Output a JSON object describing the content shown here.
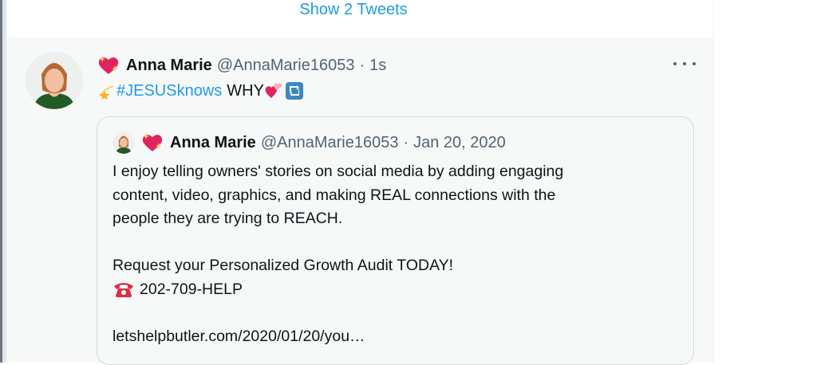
{
  "thread": {
    "show_more_label": "Show 2 Tweets"
  },
  "tweet": {
    "display_name": "Anna Marie",
    "handle": "@AnnaMarie16053",
    "separator": "·",
    "time": "1s",
    "hashtag": "#JESUSknows",
    "text_after": "WHY",
    "emoji": [
      "sparkling-heart-icon",
      "dizzy-star-icon",
      "two-hearts-icon",
      "retweet-box-icon"
    ]
  },
  "quote": {
    "display_name": "Anna Marie",
    "handle": "@AnnaMarie16053",
    "separator": "·",
    "date": "Jan 20, 2020",
    "lines": [
      "I enjoy telling owners' stories on social media by adding engaging",
      "content, video, graphics, and making REAL connections with the",
      "people they are trying to REACH."
    ],
    "cta": "Request your Personalized Growth Audit TODAY!",
    "phone": "202-709-HELP",
    "link": "letshelpbutler.com/2020/01/20/you…"
  },
  "colors": {
    "link_blue": "#1d9bf0",
    "secondary_text": "#536471",
    "tweet_background": "#f7f9f9",
    "border": "#cfd9de"
  }
}
